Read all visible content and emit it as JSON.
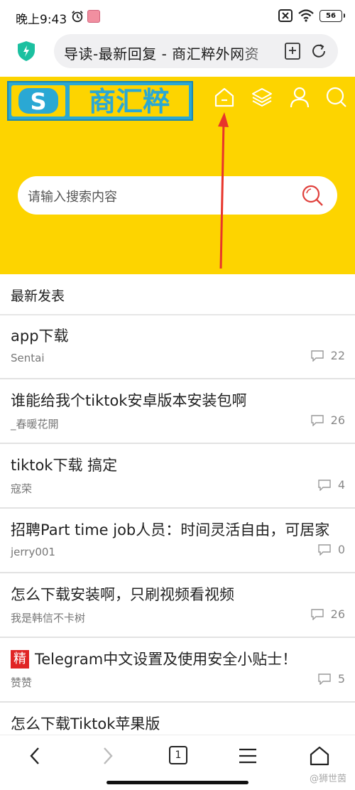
{
  "status_bar": {
    "time": "晚上9:43",
    "battery": "56"
  },
  "browser": {
    "page_title": "导读-最新回复 - 商汇粹外网资",
    "tab_count": "1"
  },
  "site": {
    "logo_letter": "S",
    "logo_text": "商汇粹",
    "search_placeholder": "请输入搜索内容",
    "brand_color": "#fdd400",
    "logo_color": "#2aa8d4"
  },
  "section": {
    "title": "最新发表"
  },
  "posts": [
    {
      "title": "app下载",
      "author": "Sentai",
      "comments": "22",
      "featured": false
    },
    {
      "title": "谁能给我个tiktok安卓版本安装包啊",
      "author": "_春暖花開",
      "comments": "26",
      "featured": false
    },
    {
      "title": "tiktok下载 搞定",
      "author": "寇荣",
      "comments": "4",
      "featured": false
    },
    {
      "title": "招聘Part time job人员：时间灵活自由，可居家",
      "author": "jerry001",
      "comments": "0",
      "featured": false
    },
    {
      "title": "怎么下载安装啊，只刷视频看视频",
      "author": "我是韩信不卡树",
      "comments": "26",
      "featured": false
    },
    {
      "title": "Telegram中文设置及使用安全小贴士！",
      "author": "赞赞",
      "comments": "5",
      "featured": true,
      "badge": "精"
    },
    {
      "title": "怎么下载Tiktok苹果版",
      "author": "",
      "comments": "",
      "featured": false
    }
  ],
  "watermark": "@狮世茵"
}
